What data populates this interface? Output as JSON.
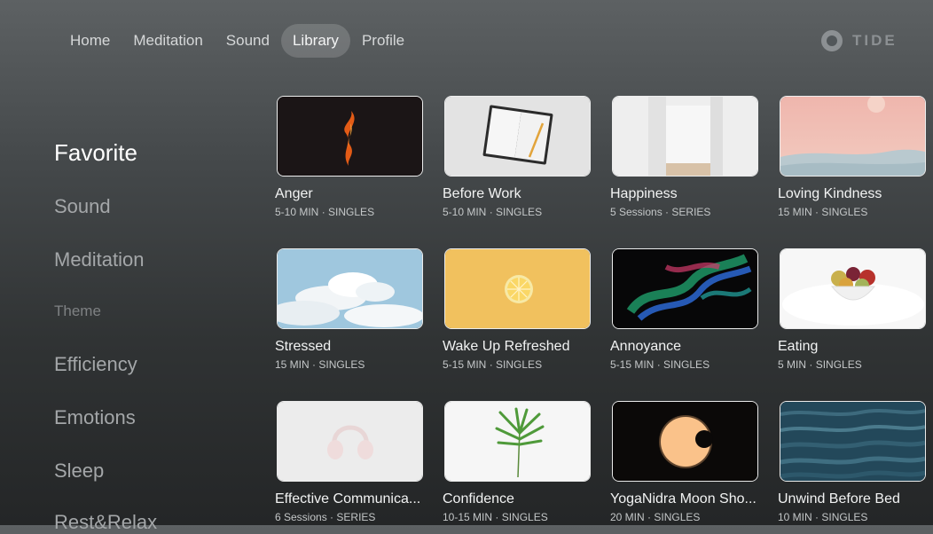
{
  "nav": {
    "tabs": [
      {
        "label": "Home"
      },
      {
        "label": "Meditation"
      },
      {
        "label": "Sound"
      },
      {
        "label": "Library"
      },
      {
        "label": "Profile"
      }
    ],
    "active_tab": "Library"
  },
  "brand": {
    "name": "TIDE",
    "logo_icon": "tide-ring-logo-icon"
  },
  "sidebar": {
    "items": [
      {
        "label": "Favorite"
      },
      {
        "label": "Sound"
      },
      {
        "label": "Meditation"
      },
      {
        "label": "Theme"
      },
      {
        "label": "Efficiency"
      },
      {
        "label": "Emotions"
      },
      {
        "label": "Sleep"
      },
      {
        "label": "Rest&Relax"
      }
    ],
    "active_item": "Favorite"
  },
  "cards": [
    {
      "title": "Anger",
      "duration": "5-10 MIN",
      "type": "SINGLES",
      "image": "orange-flame"
    },
    {
      "title": "Before Work",
      "duration": "5-10 MIN",
      "type": "SINGLES",
      "image": "notebook-pencil"
    },
    {
      "title": "Happiness",
      "duration": "5 Sessions",
      "type": "SERIES",
      "image": "open-white-door"
    },
    {
      "title": "Loving Kindness",
      "duration": "15 MIN",
      "type": "SINGLES",
      "image": "pink-sky-dunes"
    },
    {
      "title": "Stressed",
      "duration": "15 MIN",
      "type": "SINGLES",
      "image": "blue-sky-clouds"
    },
    {
      "title": "Wake Up Refreshed",
      "duration": "5-15 MIN",
      "type": "SINGLES",
      "image": "lemon-slice"
    },
    {
      "title": "Annoyance",
      "duration": "5-15 MIN",
      "type": "SINGLES",
      "image": "aurora-swirl"
    },
    {
      "title": "Eating",
      "duration": "5 MIN",
      "type": "SINGLES",
      "image": "fruit-bowl"
    },
    {
      "title": "Effective Communica...",
      "duration": "6 Sessions",
      "type": "SERIES",
      "image": "pink-headphones"
    },
    {
      "title": "Confidence",
      "duration": "10-15 MIN",
      "type": "SINGLES",
      "image": "green-leaf"
    },
    {
      "title": "YogaNidra Moon Sho...",
      "duration": "20 MIN",
      "type": "SINGLES",
      "image": "crescent-moon"
    },
    {
      "title": "Unwind Before Bed",
      "duration": "10 MIN",
      "type": "SINGLES",
      "image": "dark-water-waves"
    }
  ],
  "meta_separator": "·"
}
